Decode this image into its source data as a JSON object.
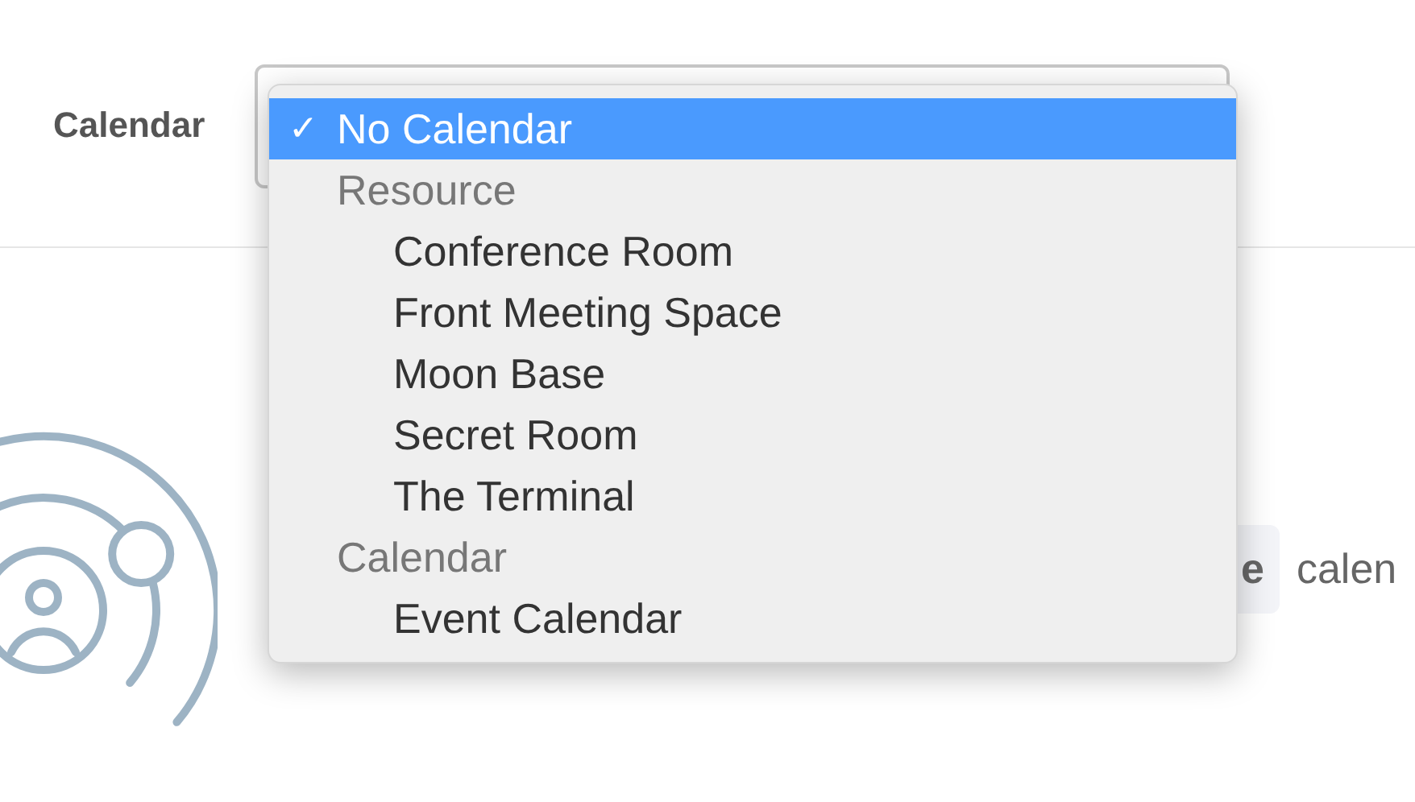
{
  "calendar_field": {
    "label": "Calendar"
  },
  "dropdown": {
    "items": [
      {
        "kind": "option",
        "mark": "✓",
        "label": "No Calendar",
        "selected": true
      },
      {
        "kind": "group",
        "label": "Resource",
        "selected": false
      },
      {
        "kind": "option",
        "label": "Conference Room",
        "selected": false
      },
      {
        "kind": "option",
        "label": "Front Meeting Space",
        "selected": false
      },
      {
        "kind": "option",
        "label": "Moon Base",
        "selected": false
      },
      {
        "kind": "option",
        "label": "Secret Room",
        "selected": false
      },
      {
        "kind": "option",
        "label": "The Terminal",
        "selected": false
      },
      {
        "kind": "group",
        "label": "Calendar",
        "selected": false
      },
      {
        "kind": "option",
        "label": "Event Calendar",
        "selected": false
      }
    ]
  },
  "body": {
    "chip": "e",
    "text": "calen"
  }
}
